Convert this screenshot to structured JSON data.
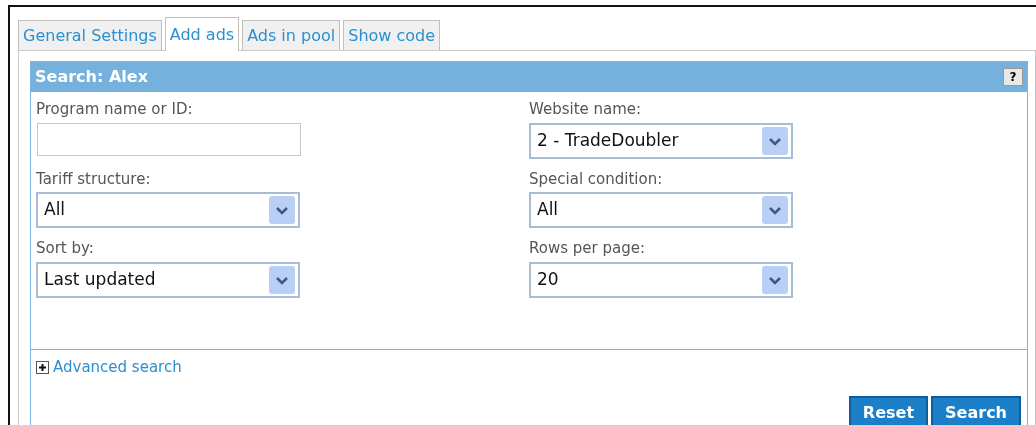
{
  "tabs": [
    {
      "label": "General Settings",
      "selected": false
    },
    {
      "label": "Add ads",
      "selected": true
    },
    {
      "label": "Ads in pool",
      "selected": false
    },
    {
      "label": "Show code",
      "selected": false
    }
  ],
  "panel": {
    "title": "Search: Alex",
    "help": "?",
    "fields": [
      {
        "kind": "text",
        "label": "Program name or ID:"
      },
      {
        "kind": "select",
        "label": "Website name:",
        "value": "2 - TradeDoubler"
      },
      {
        "kind": "select",
        "label": "Tariff structure:",
        "value": "All"
      },
      {
        "kind": "select",
        "label": "Special condition:",
        "value": "All"
      },
      {
        "kind": "select",
        "label": "Sort by:",
        "value": "Last updated"
      },
      {
        "kind": "select",
        "label": "Rows per page:",
        "value": "20"
      }
    ],
    "advanced": {
      "label": "Advanced search",
      "expanded": false
    },
    "buttons": [
      "Reset",
      "Search"
    ]
  }
}
